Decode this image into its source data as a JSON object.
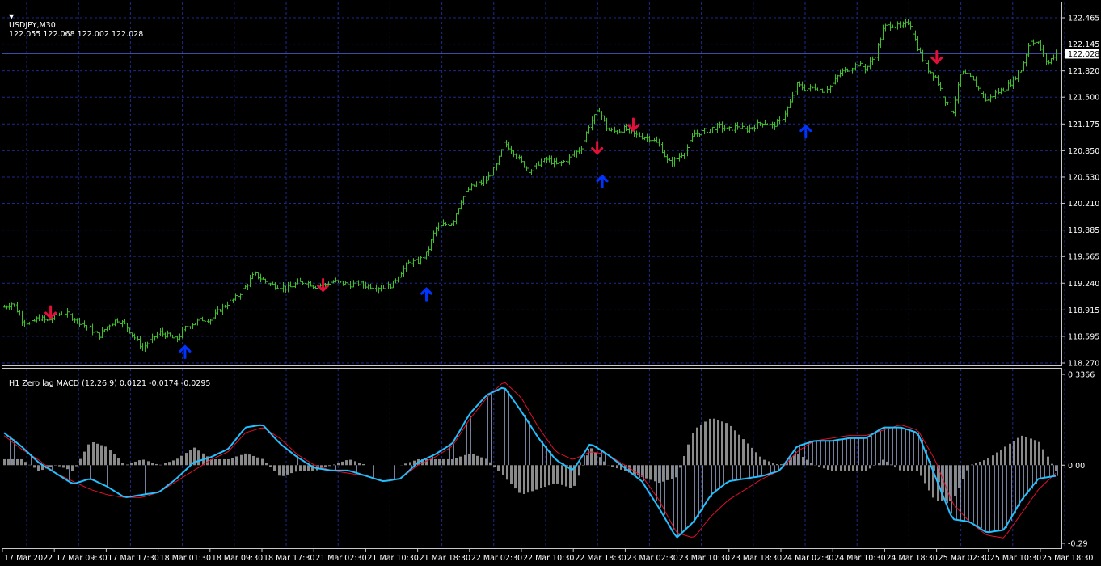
{
  "main": {
    "symbol_label": "USDJPY,M30",
    "ohlc": "122.055 122.068 122.002 122.028",
    "current_price": "122.028",
    "price_ticks": [
      "122.465",
      "122.145",
      "121.820",
      "121.500",
      "121.175",
      "120.850",
      "120.530",
      "120.210",
      "119.885",
      "119.565",
      "119.240",
      "118.915",
      "118.595",
      "118.270"
    ],
    "ylim": [
      118.27,
      122.465
    ],
    "price_path": [
      [
        0,
        118.95
      ],
      [
        0.5,
        119.0
      ],
      [
        1,
        118.8
      ],
      [
        1.5,
        118.74
      ],
      [
        2,
        118.82
      ],
      [
        2.5,
        118.78
      ],
      [
        3,
        118.85
      ],
      [
        3.5,
        118.88
      ],
      [
        4,
        118.82
      ],
      [
        4.5,
        118.75
      ],
      [
        5,
        118.68
      ],
      [
        5.5,
        118.6
      ],
      [
        6,
        118.72
      ],
      [
        6.5,
        118.8
      ],
      [
        7,
        118.74
      ],
      [
        7.5,
        118.6
      ],
      [
        8,
        118.45
      ],
      [
        8.5,
        118.55
      ],
      [
        9,
        118.64
      ],
      [
        9.5,
        118.6
      ],
      [
        10,
        118.55
      ],
      [
        10.5,
        118.7
      ],
      [
        11,
        118.76
      ],
      [
        11.5,
        118.8
      ],
      [
        12,
        118.8
      ],
      [
        12.5,
        118.92
      ],
      [
        13,
        119.0
      ],
      [
        13.5,
        119.08
      ],
      [
        14,
        119.2
      ],
      [
        14.5,
        119.35
      ],
      [
        15,
        119.28
      ],
      [
        15.5,
        119.22
      ],
      [
        16,
        119.2
      ],
      [
        16.5,
        119.18
      ],
      [
        17,
        119.24
      ],
      [
        17.5,
        119.26
      ],
      [
        18,
        119.2
      ],
      [
        18.5,
        119.22
      ],
      [
        19,
        119.26
      ],
      [
        19.5,
        119.25
      ],
      [
        20,
        119.22
      ],
      [
        20.5,
        119.24
      ],
      [
        21,
        119.21
      ],
      [
        21.5,
        119.2
      ],
      [
        22,
        119.18
      ],
      [
        22.5,
        119.22
      ],
      [
        23,
        119.38
      ],
      [
        23.5,
        119.5
      ],
      [
        24,
        119.5
      ],
      [
        24.5,
        119.6
      ],
      [
        25,
        119.9
      ],
      [
        25.5,
        119.95
      ],
      [
        26,
        119.98
      ],
      [
        26.5,
        120.25
      ],
      [
        27,
        120.4
      ],
      [
        27.5,
        120.45
      ],
      [
        28,
        120.5
      ],
      [
        28.5,
        120.65
      ],
      [
        29,
        120.95
      ],
      [
        29.5,
        120.85
      ],
      [
        30,
        120.7
      ],
      [
        30.5,
        120.6
      ],
      [
        31,
        120.7
      ],
      [
        31.5,
        120.75
      ],
      [
        32,
        120.68
      ],
      [
        32.5,
        120.72
      ],
      [
        33,
        120.8
      ],
      [
        33.5,
        120.9
      ],
      [
        34,
        121.2
      ],
      [
        34.5,
        121.35
      ],
      [
        35,
        121.1
      ],
      [
        35.5,
        121.08
      ],
      [
        36,
        121.12
      ],
      [
        36.5,
        121.05
      ],
      [
        37,
        121.02
      ],
      [
        37.5,
        121.0
      ],
      [
        38,
        120.92
      ],
      [
        38.5,
        120.7
      ],
      [
        39,
        120.75
      ],
      [
        39.5,
        120.85
      ],
      [
        40,
        121.05
      ],
      [
        40.5,
        121.08
      ],
      [
        41,
        121.12
      ],
      [
        41.5,
        121.15
      ],
      [
        42,
        121.1
      ],
      [
        42.5,
        121.15
      ],
      [
        43,
        121.1
      ],
      [
        43.5,
        121.15
      ],
      [
        44,
        121.2
      ],
      [
        44.5,
        121.15
      ],
      [
        45,
        121.2
      ],
      [
        45.5,
        121.4
      ],
      [
        46,
        121.65
      ],
      [
        46.5,
        121.6
      ],
      [
        47,
        121.62
      ],
      [
        47.5,
        121.58
      ],
      [
        48,
        121.65
      ],
      [
        48.5,
        121.8
      ],
      [
        49,
        121.85
      ],
      [
        49.5,
        121.9
      ],
      [
        50,
        121.85
      ],
      [
        50.5,
        122.0
      ],
      [
        51,
        122.35
      ],
      [
        51.5,
        122.38
      ],
      [
        52,
        122.35
      ],
      [
        52.5,
        122.42
      ],
      [
        53,
        122.1
      ],
      [
        53.5,
        121.85
      ],
      [
        54,
        121.75
      ],
      [
        54.5,
        121.5
      ],
      [
        55,
        121.3
      ],
      [
        55.5,
        121.8
      ],
      [
        56,
        121.75
      ],
      [
        56.5,
        121.6
      ],
      [
        57,
        121.45
      ],
      [
        57.5,
        121.55
      ],
      [
        58,
        121.6
      ],
      [
        58.5,
        121.7
      ],
      [
        59,
        121.85
      ],
      [
        59.5,
        122.2
      ],
      [
        60,
        122.15
      ],
      [
        60.5,
        121.9
      ],
      [
        61,
        122.05
      ]
    ],
    "down_arrows": [
      [
        2.7,
        118.82
      ],
      [
        18.5,
        119.15
      ],
      [
        34.4,
        120.82
      ],
      [
        36.5,
        121.1
      ],
      [
        54.1,
        121.92
      ]
    ],
    "up_arrows": [
      [
        10.5,
        118.55
      ],
      [
        24.5,
        119.25
      ],
      [
        34.7,
        120.62
      ],
      [
        46.5,
        121.23
      ]
    ],
    "up_color": "#0033ff",
    "down_color": "#e0103a",
    "bar_color": "#3fbe2c"
  },
  "sub": {
    "indicator_label": "H1 Zero lag MACD (12,26,9) 0.0121 -0.0174 -0.0295",
    "ticks": [
      "0.3366",
      "0.00",
      "-0.29"
    ],
    "ylim": [
      -0.29,
      0.3366
    ],
    "macd_path": [
      [
        0,
        0.12
      ],
      [
        1,
        0.07
      ],
      [
        2,
        0.01
      ],
      [
        3,
        -0.03
      ],
      [
        4,
        -0.07
      ],
      [
        5,
        -0.05
      ],
      [
        6,
        -0.08
      ],
      [
        7,
        -0.12
      ],
      [
        8,
        -0.11
      ],
      [
        9,
        -0.1
      ],
      [
        10,
        -0.05
      ],
      [
        11,
        0.01
      ],
      [
        12,
        0.03
      ],
      [
        13,
        0.06
      ],
      [
        14,
        0.14
      ],
      [
        15,
        0.15
      ],
      [
        16,
        0.08
      ],
      [
        17,
        0.03
      ],
      [
        18,
        -0.01
      ],
      [
        19,
        -0.02
      ],
      [
        20,
        -0.02
      ],
      [
        21,
        -0.04
      ],
      [
        22,
        -0.06
      ],
      [
        23,
        -0.05
      ],
      [
        24,
        0.01
      ],
      [
        25,
        0.04
      ],
      [
        26,
        0.08
      ],
      [
        27,
        0.19
      ],
      [
        28,
        0.26
      ],
      [
        29,
        0.29
      ],
      [
        30,
        0.2
      ],
      [
        31,
        0.1
      ],
      [
        32,
        0.02
      ],
      [
        33,
        -0.02
      ],
      [
        34,
        0.08
      ],
      [
        35,
        0.04
      ],
      [
        36,
        -0.01
      ],
      [
        37,
        -0.06
      ],
      [
        38,
        -0.16
      ],
      [
        39,
        -0.27
      ],
      [
        40,
        -0.21
      ],
      [
        41,
        -0.11
      ],
      [
        42,
        -0.06
      ],
      [
        43,
        -0.05
      ],
      [
        44,
        -0.04
      ],
      [
        45,
        -0.02
      ],
      [
        46,
        0.07
      ],
      [
        47,
        0.09
      ],
      [
        48,
        0.09
      ],
      [
        49,
        0.1
      ],
      [
        50,
        0.1
      ],
      [
        51,
        0.14
      ],
      [
        52,
        0.14
      ],
      [
        53,
        0.12
      ],
      [
        54,
        -0.04
      ],
      [
        55,
        -0.2
      ],
      [
        56,
        -0.21
      ],
      [
        57,
        -0.25
      ],
      [
        58,
        -0.24
      ],
      [
        59,
        -0.13
      ],
      [
        60,
        -0.05
      ],
      [
        61,
        -0.04
      ]
    ],
    "signal_path": [
      [
        0,
        0.11
      ],
      [
        1,
        0.06
      ],
      [
        2,
        0.02
      ],
      [
        3,
        -0.03
      ],
      [
        4,
        -0.06
      ],
      [
        5,
        -0.09
      ],
      [
        6,
        -0.11
      ],
      [
        7,
        -0.12
      ],
      [
        8,
        -0.12
      ],
      [
        9,
        -0.1
      ],
      [
        10,
        -0.06
      ],
      [
        11,
        -0.02
      ],
      [
        12,
        0.02
      ],
      [
        13,
        0.05
      ],
      [
        14,
        0.12
      ],
      [
        15,
        0.14
      ],
      [
        16,
        0.1
      ],
      [
        17,
        0.04
      ],
      [
        18,
        0.0
      ],
      [
        19,
        -0.02
      ],
      [
        20,
        -0.03
      ],
      [
        21,
        -0.04
      ],
      [
        22,
        -0.06
      ],
      [
        23,
        -0.05
      ],
      [
        24,
        0.0
      ],
      [
        25,
        0.03
      ],
      [
        26,
        0.07
      ],
      [
        27,
        0.17
      ],
      [
        28,
        0.25
      ],
      [
        29,
        0.31
      ],
      [
        30,
        0.25
      ],
      [
        31,
        0.14
      ],
      [
        32,
        0.05
      ],
      [
        33,
        0.02
      ],
      [
        34,
        0.05
      ],
      [
        35,
        0.04
      ],
      [
        36,
        0.0
      ],
      [
        37,
        -0.04
      ],
      [
        38,
        -0.13
      ],
      [
        39,
        -0.25
      ],
      [
        40,
        -0.27
      ],
      [
        41,
        -0.19
      ],
      [
        42,
        -0.13
      ],
      [
        43,
        -0.09
      ],
      [
        44,
        -0.05
      ],
      [
        45,
        -0.02
      ],
      [
        46,
        0.05
      ],
      [
        47,
        0.09
      ],
      [
        48,
        0.1
      ],
      [
        49,
        0.11
      ],
      [
        50,
        0.11
      ],
      [
        51,
        0.13
      ],
      [
        52,
        0.15
      ],
      [
        53,
        0.13
      ],
      [
        54,
        0.02
      ],
      [
        55,
        -0.14
      ],
      [
        56,
        -0.21
      ],
      [
        57,
        -0.26
      ],
      [
        58,
        -0.27
      ],
      [
        59,
        -0.18
      ],
      [
        60,
        -0.09
      ],
      [
        61,
        -0.03
      ]
    ],
    "macd_color": "#22c0ff",
    "signal_color": "#e0102a",
    "hist_color": "#8a8a8a"
  },
  "time_labels": [
    "17 Mar 2022",
    "17 Mar 09:30",
    "17 Mar 17:30",
    "18 Mar 01:30",
    "18 Mar 09:30",
    "18 Mar 17:30",
    "21 Mar 02:30",
    "21 Mar 10:30",
    "21 Mar 18:30",
    "22 Mar 02:30",
    "22 Mar 10:30",
    "22 Mar 18:30",
    "23 Mar 02:30",
    "23 Mar 10:30",
    "23 Mar 18:30",
    "24 Mar 02:30",
    "24 Mar 10:30",
    "24 Mar 18:30",
    "25 Mar 02:30",
    "25 Mar 10:30",
    "25 Mar 18:30"
  ],
  "grid_color": "#1c2a8c"
}
